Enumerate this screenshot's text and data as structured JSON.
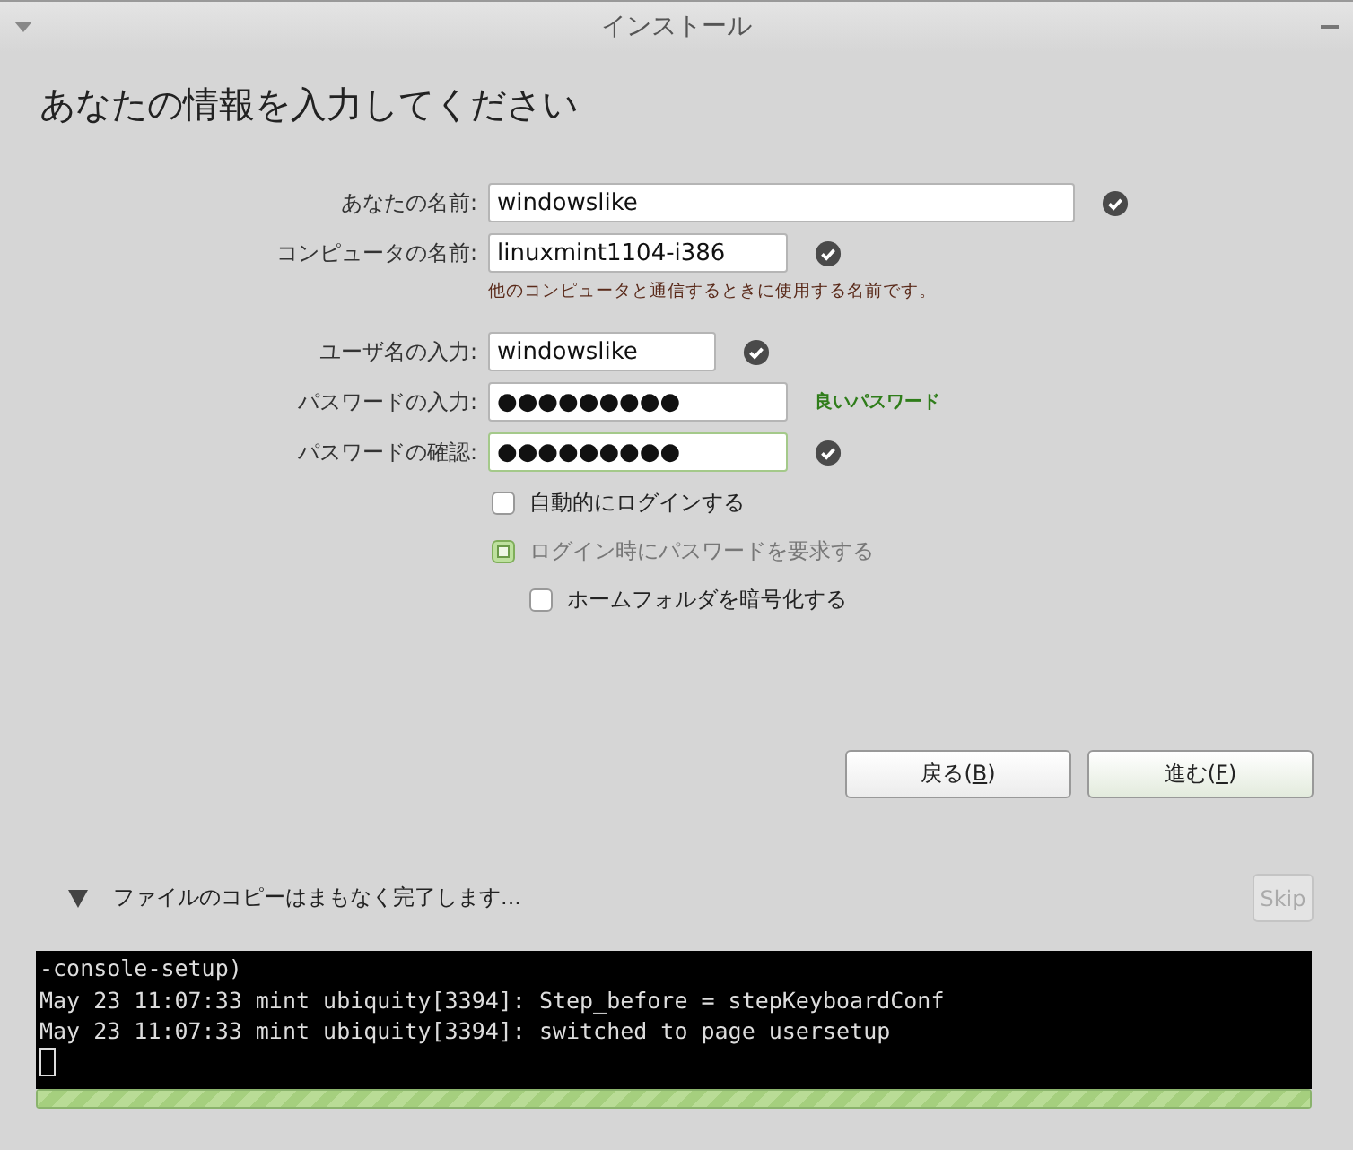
{
  "window": {
    "title": "インストール"
  },
  "heading": "あなたの情報を入力してください",
  "fields": [
    {
      "label": "あなたの名前:",
      "value": "windowslike",
      "kind": "checked",
      "focused": false
    },
    {
      "label": "コンピュータの名前:",
      "value": "linuxmint1104-i386",
      "kind": "checked",
      "focused": false,
      "hint": "他のコンピュータと通信するときに使用する名前です。"
    },
    {
      "label": "ユーザ名の入力:",
      "value": "windowslike",
      "kind": "checked",
      "focused": false
    },
    {
      "label": "パスワードの入力:",
      "value": "●●●●●●●●●",
      "kind": "strength",
      "status_text": "良いパスワード",
      "focused": false
    },
    {
      "label": "パスワードの確認:",
      "value": "●●●●●●●●●",
      "kind": "checked",
      "focused": true
    }
  ],
  "options": [
    {
      "label": "自動的にログインする",
      "checked": false,
      "disabled": false,
      "indented": false
    },
    {
      "label": "ログイン時にパスワードを要求する",
      "checked": true,
      "disabled": true,
      "indented": false
    },
    {
      "label": "ホームフォルダを暗号化する",
      "checked": false,
      "disabled": false,
      "indented": true
    }
  ],
  "buttons": [
    {
      "before": "戻る(",
      "mnemonic": "B",
      "after": ")",
      "primary": false
    },
    {
      "before": "進む(",
      "mnemonic": "F",
      "after": ")",
      "primary": true
    }
  ],
  "progress": {
    "expanded": true,
    "text": "ファイルのコピーはまもなく完了します...",
    "skip": {
      "label": "Skip",
      "disabled": true
    },
    "level": 1
  },
  "console": {
    "lines": [
      "-console-setup)",
      "May 23 11:07:33 mint ubiquity[3394]: Step_before = stepKeyboardConf",
      "May 23 11:07:33 mint ubiquity[3394]: switched to page usersetup"
    ]
  }
}
